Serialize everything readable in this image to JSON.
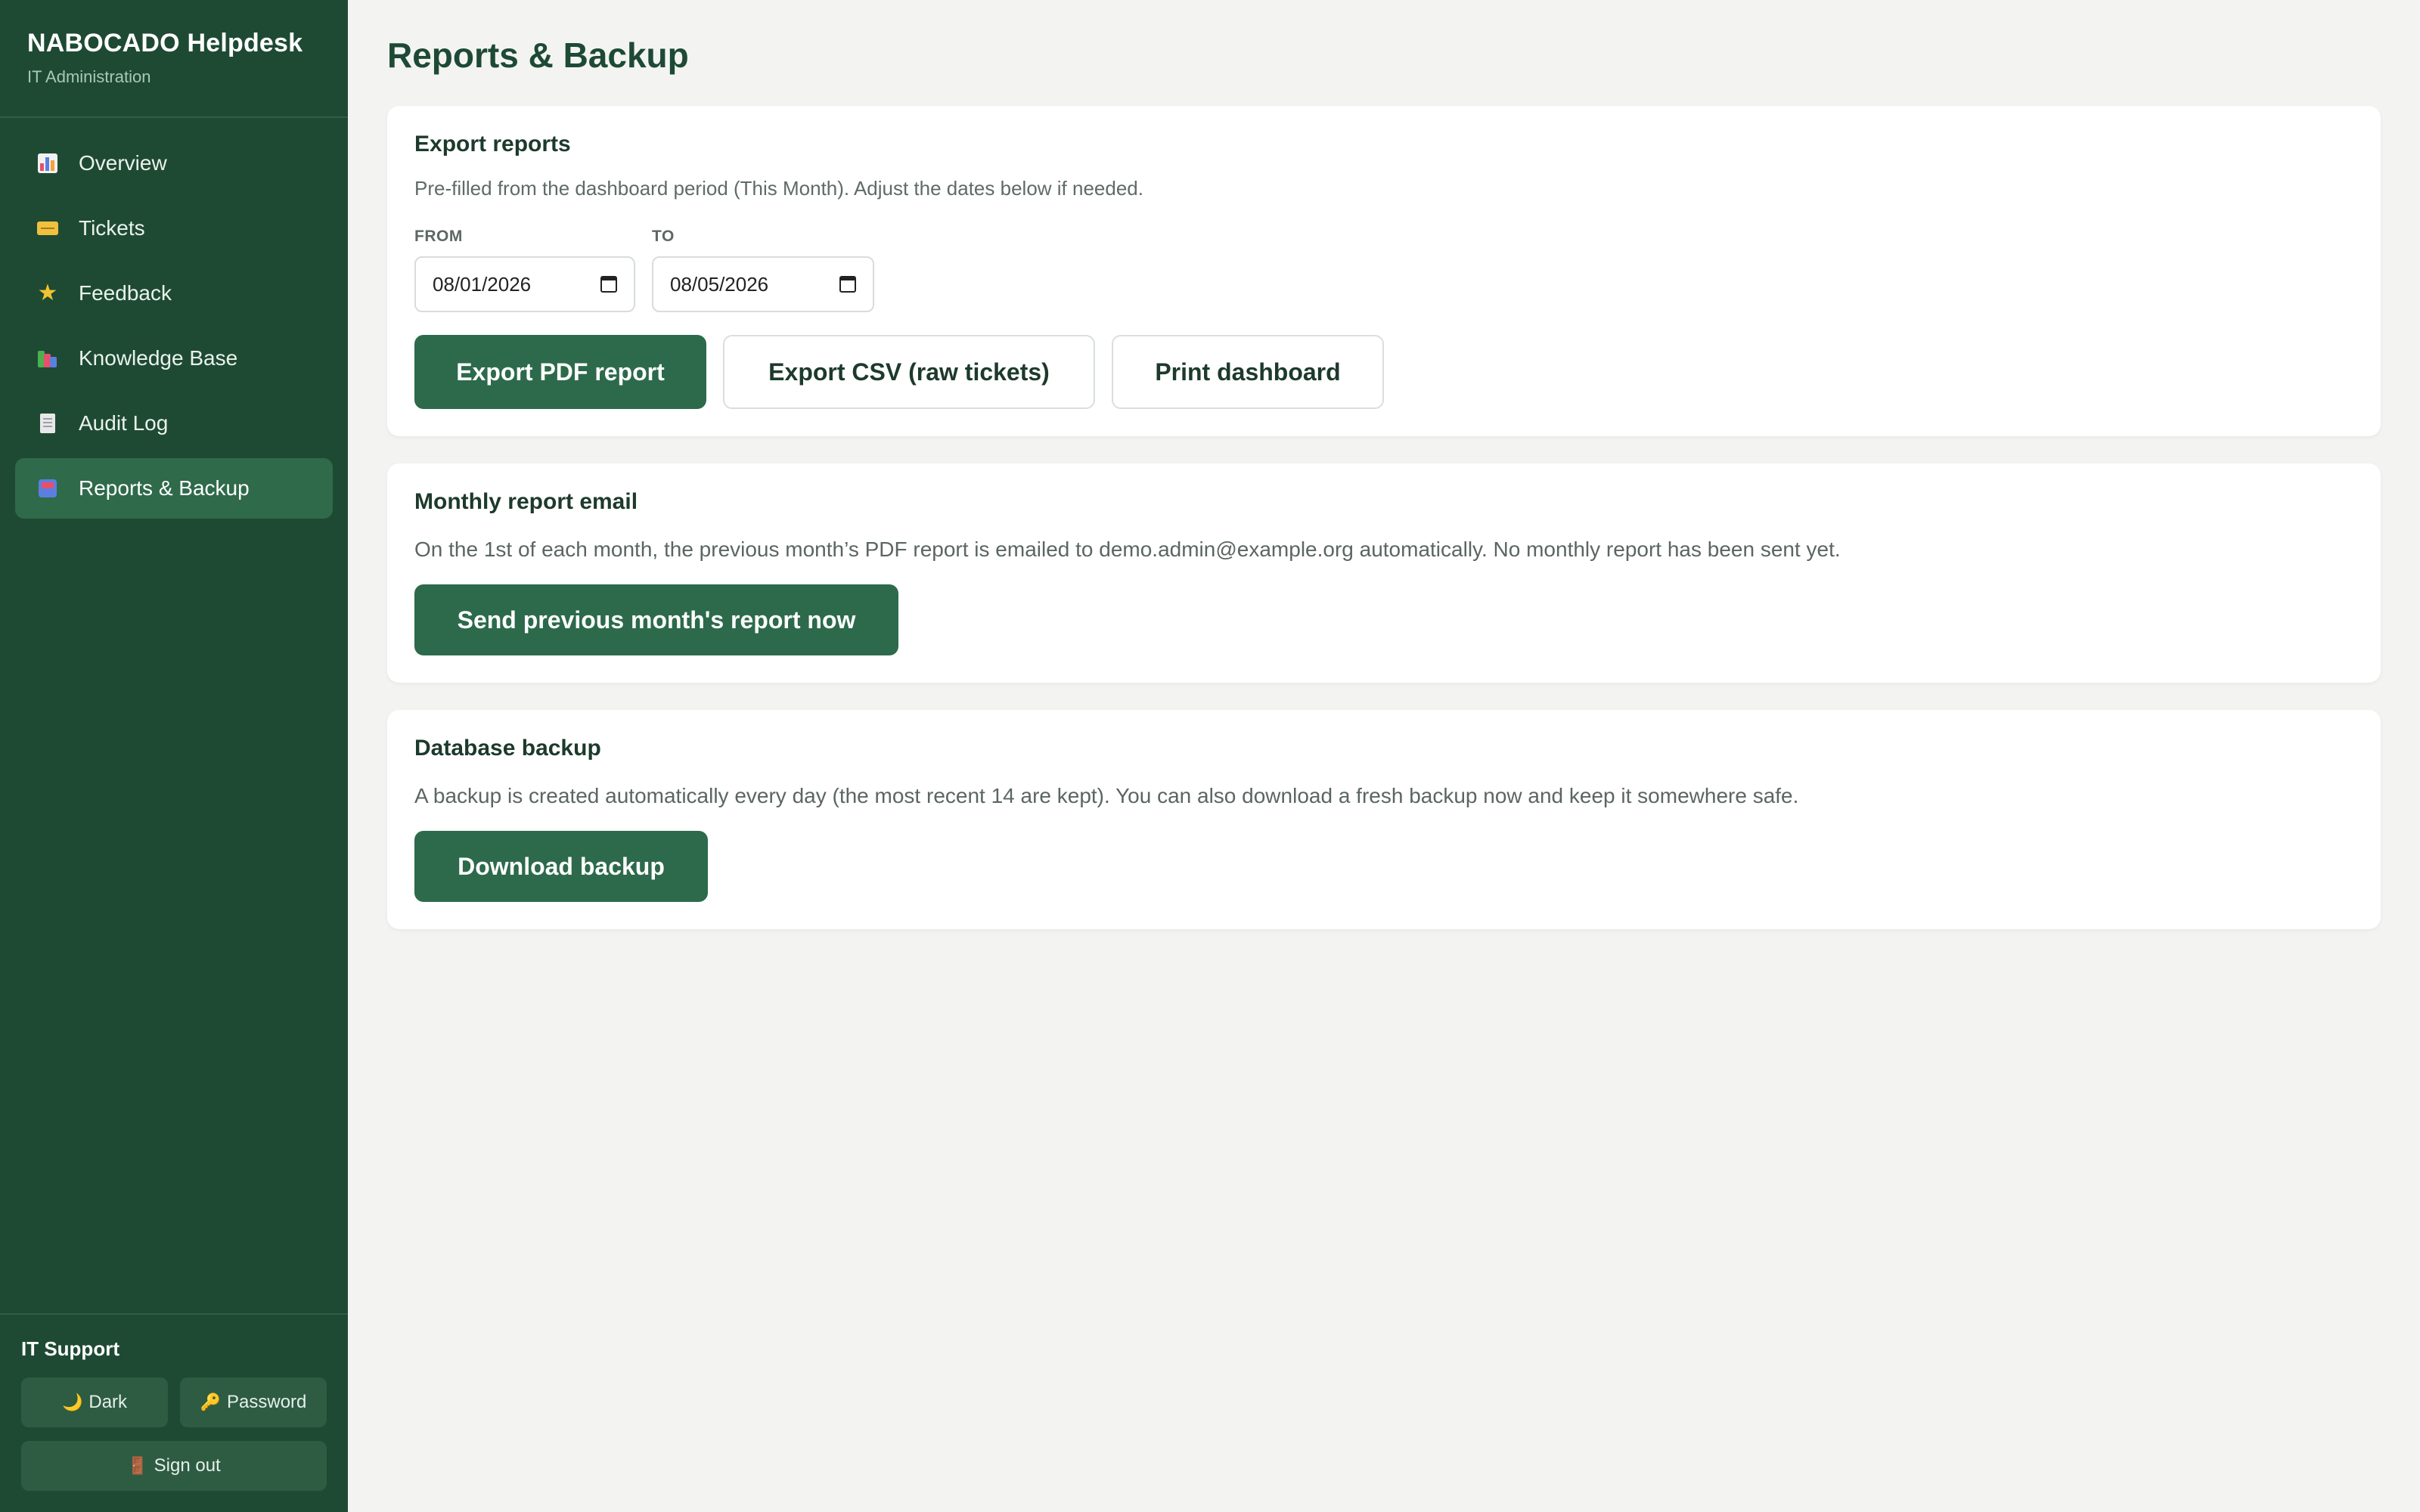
{
  "sidebar": {
    "brand_title": "NABOCADO Helpdesk",
    "brand_subtitle": "IT Administration",
    "items": [
      {
        "label": "Overview",
        "icon": "bar-chart-icon"
      },
      {
        "label": "Tickets",
        "icon": "ticket-icon"
      },
      {
        "label": "Feedback",
        "icon": "star-icon"
      },
      {
        "label": "Knowledge Base",
        "icon": "books-icon"
      },
      {
        "label": "Audit Log",
        "icon": "page-icon"
      },
      {
        "label": "Reports & Backup",
        "icon": "inbox-icon",
        "active": true
      }
    ],
    "footer": {
      "title": "IT Support",
      "dark_label": "Dark",
      "dark_icon": "🌙",
      "password_label": "Password",
      "password_icon": "🔑",
      "signout_label": "Sign out",
      "signout_icon": "🚪"
    }
  },
  "main": {
    "page_title": "Reports & Backup",
    "export": {
      "title": "Export reports",
      "description": "Pre-filled from the dashboard period (This Month). Adjust the dates below if needed.",
      "from_label": "FROM",
      "from_value": "08/01/2026",
      "to_label": "TO",
      "to_value": "08/05/2026",
      "pdf_button": "Export PDF report",
      "csv_button": "Export CSV (raw tickets)",
      "print_button": "Print dashboard"
    },
    "monthly": {
      "title": "Monthly report email",
      "description": "On the 1st of each month, the previous month’s PDF report is emailed to demo.admin@example.org automatically. No monthly report has been sent yet.",
      "send_button": "Send previous month's report now"
    },
    "backup": {
      "title": "Database backup",
      "description": "A backup is created automatically every day (the most recent 14 are kept). You can also download a fresh backup now and keep it somewhere safe.",
      "download_button": "Download backup"
    }
  },
  "colors": {
    "sidebar_bg": "#1e4a33",
    "active_item": "#2f6a4a",
    "primary_button": "#2c6a4b",
    "page_bg": "#f3f4f2"
  }
}
